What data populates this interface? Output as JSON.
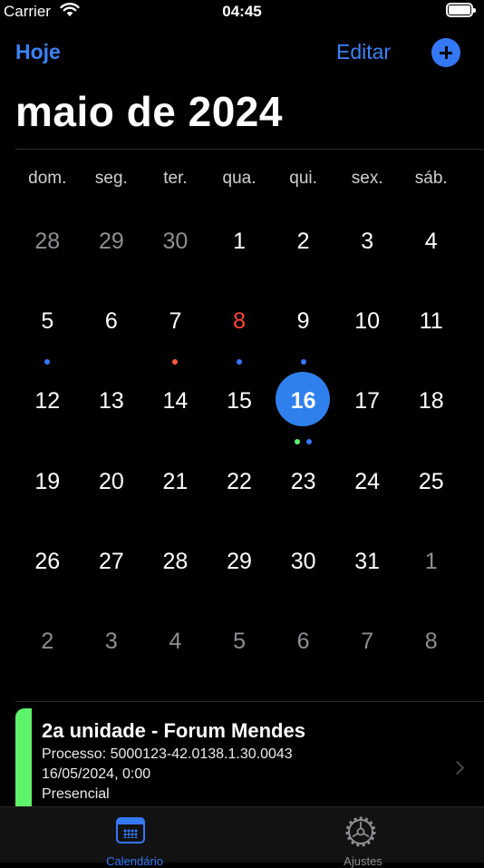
{
  "status_bar": {
    "carrier": "Carrier",
    "time": "04:45"
  },
  "nav": {
    "today_label": "Hoje",
    "edit_label": "Editar",
    "add_icon": "plus-circle-icon"
  },
  "calendar": {
    "month_title": "maio de 2024",
    "weekdays": [
      "dom.",
      "seg.",
      "ter.",
      "qua.",
      "qui.",
      "sex.",
      "sáb."
    ],
    "weeks": [
      [
        {
          "d": "28",
          "muted": true
        },
        {
          "d": "29",
          "muted": true
        },
        {
          "d": "30",
          "muted": true
        },
        {
          "d": "1"
        },
        {
          "d": "2"
        },
        {
          "d": "3"
        },
        {
          "d": "4"
        }
      ],
      [
        {
          "d": "5",
          "dots": [
            "#3478f6"
          ]
        },
        {
          "d": "6"
        },
        {
          "d": "7",
          "dots": [
            "#ff5a3d"
          ]
        },
        {
          "d": "8",
          "today": true,
          "dots": [
            "#3478f6"
          ]
        },
        {
          "d": "9",
          "dots": [
            "#3478f6"
          ]
        },
        {
          "d": "10"
        },
        {
          "d": "11"
        }
      ],
      [
        {
          "d": "12"
        },
        {
          "d": "13"
        },
        {
          "d": "14"
        },
        {
          "d": "15"
        },
        {
          "d": "16",
          "selected": true,
          "dots": [
            "#5ef26a",
            "#3478f6"
          ]
        },
        {
          "d": "17"
        },
        {
          "d": "18"
        }
      ],
      [
        {
          "d": "19"
        },
        {
          "d": "20"
        },
        {
          "d": "21"
        },
        {
          "d": "22"
        },
        {
          "d": "23"
        },
        {
          "d": "24"
        },
        {
          "d": "25"
        }
      ],
      [
        {
          "d": "26"
        },
        {
          "d": "27"
        },
        {
          "d": "28"
        },
        {
          "d": "29"
        },
        {
          "d": "30"
        },
        {
          "d": "31"
        },
        {
          "d": "1",
          "muted": true
        }
      ],
      [
        {
          "d": "2",
          "muted": true
        },
        {
          "d": "3",
          "muted": true
        },
        {
          "d": "4",
          "muted": true
        },
        {
          "d": "5",
          "muted": true
        },
        {
          "d": "6",
          "muted": true
        },
        {
          "d": "7",
          "muted": true
        },
        {
          "d": "8",
          "muted": true
        }
      ]
    ]
  },
  "event": {
    "title": "2a unidade - Forum Mendes",
    "process": "Processo: 5000123-42.0138.1.30.0043",
    "datetime": "16/05/2024, 0:00",
    "mode": "Presencial",
    "color": "#5ef26a"
  },
  "tabs": [
    {
      "label": "Calendário",
      "icon": "calendar-icon",
      "active": true
    },
    {
      "label": "Ajustes",
      "icon": "gear-icon",
      "active": false
    }
  ],
  "colors": {
    "accent": "#3478f6",
    "background": "#000000",
    "today": "#ff453a"
  }
}
